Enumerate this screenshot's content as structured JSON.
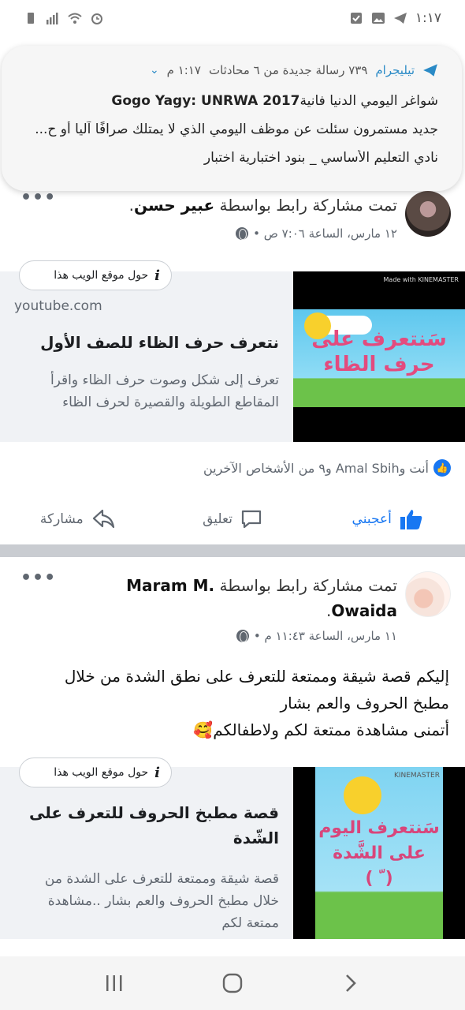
{
  "status_bar": {
    "time": "١:١٧",
    "icons": [
      "battery-icon",
      "signal-icon",
      "wifi-icon",
      "alarm-icon",
      "check-box-icon",
      "image-icon",
      "telegram-icon"
    ]
  },
  "notification": {
    "app": "تيليجرام",
    "summary": "٧٣٩ رسالة جديدة من ٦ محادثات",
    "time": "١:١٧ م",
    "lines": [
      {
        "sender": "Gogo Yagy: UNRWA 2017",
        "text": "شواغر اليومي الدنيا فانية"
      },
      {
        "sender": "",
        "text": "جديد مستمرون سئلت عن موظف اليومي الذي لا يمتلك صرافًا آليا أو ح..."
      },
      {
        "sender": "",
        "text": "نادي التعليم الأساسي _ بنود اختبارية اختبار"
      }
    ]
  },
  "post1": {
    "title_prefix": "تمت مشاركة رابط بواسطة",
    "author": "عبير حسن",
    "meta": "١٢ مارس، الساعة ٧:٠٦ ص •",
    "link": {
      "pill": "حول موقع الويب هذا",
      "domain": "youtube.com",
      "title": "نتعرف حرف الظاء للصف الأول",
      "desc": "تعرف إلى شكل وصوت حرف الظاء واقرأ المقاطع الطويلة والقصيرة لحرف الظاء",
      "thumb_badge": "Made with KINEMASTER",
      "thumb_text_1": "سَنتعرف على",
      "thumb_text_2": "حرف الظاء"
    },
    "reactions": "أنت وAmal Sbih و٩ من الأشخاص الآخرين"
  },
  "actions": {
    "like": "أعجبني",
    "comment": "تعليق",
    "share": "مشاركة"
  },
  "post2": {
    "title_prefix": "تمت مشاركة رابط بواسطة",
    "author": "Maram M. Owaida",
    "meta": "١١ مارس، الساعة ١١:٤٣ م •",
    "body_lines": [
      "إليكم قصة شيقة وممتعة للتعرف على نطق الشدة من خلال",
      "مطبخ الحروف والعم بشار",
      "أتمنى مشاهدة ممتعة لكم ولاطفالكم🥰"
    ],
    "link": {
      "pill": "حول موقع الويب هذا",
      "title": "قصة مطبخ الحروف للتعرف على الشّدة",
      "desc": "قصة شيقة وممتعة للتعرف على الشدة من خلال مطبخ الحروف والعم بشار ..مشاهدة ممتعة لكم",
      "thumb_badge": "KINEMASTER",
      "thumb_text_1": "سَنتعرف اليوم",
      "thumb_text_2": "على الشَّدة",
      "thumb_text_3": "( ّ )"
    }
  },
  "nav": {
    "recent": "recent-apps-icon",
    "home": "home-icon",
    "back": "back-icon"
  }
}
